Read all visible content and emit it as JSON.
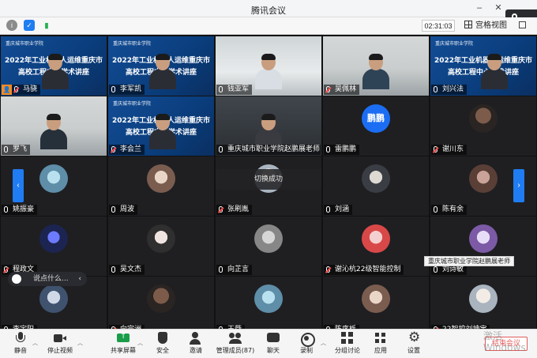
{
  "window": {
    "title": "腾讯会议"
  },
  "floating_mic": {
    "label": "正"
  },
  "status_bar": {
    "timer": "02:31:03",
    "view_label": "宫格视图"
  },
  "colors": {
    "accent": "#1f7cf2",
    "host_badge": "#f08a24",
    "end_button": "#e35a5a",
    "slide_blue": "#0a3d7c"
  },
  "slide": {
    "logo_text": "重庆城市职业学院",
    "line1": "2022年工业机器人运维重庆市",
    "line2": "高校工程中心学术讲座"
  },
  "tiles": [
    {
      "name": "马骁",
      "kind": "slide"
    },
    {
      "name": "李军凯",
      "kind": "slide"
    },
    {
      "name": "钱亚军",
      "kind": "video"
    },
    {
      "name": "吴佩林",
      "kind": "video"
    },
    {
      "name": "刘兴法",
      "kind": "slide"
    },
    {
      "name": "罗飞",
      "kind": "video"
    },
    {
      "name": "李会兰",
      "kind": "slide"
    },
    {
      "name": "重庆城市职业学院赵鹏展老师",
      "kind": "video"
    },
    {
      "name": "雷鹏鹏",
      "kind": "avatar",
      "avatar_text": "鹏鹏"
    },
    {
      "name": "谢川东",
      "kind": "avatar"
    },
    {
      "name": "姚振豪",
      "kind": "avatar"
    },
    {
      "name": "周波",
      "kind": "avatar"
    },
    {
      "name": "张刷胤",
      "kind": "avatar"
    },
    {
      "name": "刘涵",
      "kind": "avatar"
    },
    {
      "name": "陈有余",
      "kind": "avatar"
    },
    {
      "name": "程政文",
      "kind": "avatar"
    },
    {
      "name": "吴文杰",
      "kind": "avatar"
    },
    {
      "name": "向芷言",
      "kind": "avatar"
    },
    {
      "name": "谢沁杭22级智能控制",
      "kind": "avatar"
    },
    {
      "name": "刘诗敏",
      "kind": "avatar"
    },
    {
      "name": "李宇阳",
      "kind": "avatar"
    },
    {
      "name": "向宗洲",
      "kind": "avatar"
    },
    {
      "name": "王薇",
      "kind": "avatar"
    },
    {
      "name": "陈序栎",
      "kind": "avatar"
    },
    {
      "name": "22智控刘坤宝",
      "kind": "avatar"
    }
  ],
  "overlays": {
    "switch_message": "切换成功",
    "hover_name": "重庆城市职业学院赵鹏展老师",
    "chat_placeholder": "说点什么...",
    "nav_left": "‹",
    "nav_right": "›"
  },
  "toolbar": {
    "mute": "静音",
    "stop_video": "停止视频",
    "share": "共享屏幕",
    "security": "安全",
    "invite": "邀请",
    "members": "管理成员(87)",
    "chat": "聊天",
    "record": "录制",
    "breakout": "分组讨论",
    "apps": "应用",
    "settings": "设置",
    "end": "结束会议"
  },
  "watermark": "激活 Windows"
}
